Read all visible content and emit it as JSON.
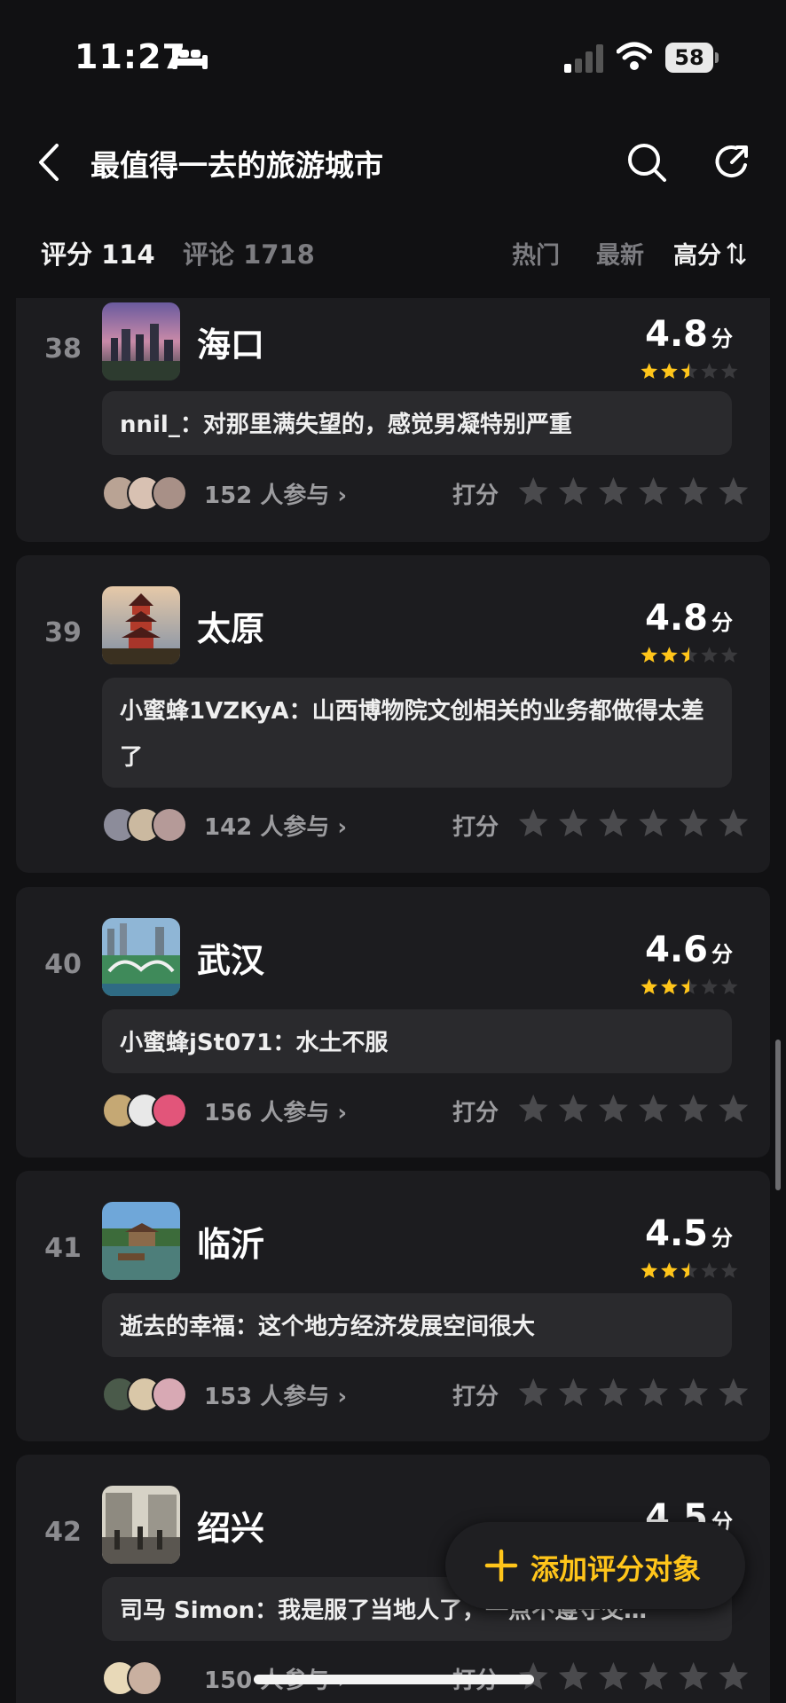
{
  "status_bar": {
    "time": "11:27",
    "battery": "58"
  },
  "nav": {
    "title": "最值得一去的旅游城市"
  },
  "tabs": {
    "ratings_label": "评分 114",
    "comments_label": "评论 1718",
    "sort_options": [
      "热门",
      "最新",
      "高分"
    ]
  },
  "score_unit": "分",
  "rate_label": "打分",
  "items": [
    {
      "rank": "38",
      "city": "海口",
      "score": "4.8",
      "comment": "nnil_：对那里满失望的，感觉男凝特别严重",
      "participants": "152 人参与",
      "stars_filled": 2.5,
      "thumb": "city-skyline-image"
    },
    {
      "rank": "39",
      "city": "太原",
      "score": "4.8",
      "comment": "小蜜蜂1VZKyA：山西博物院文创相关的业务都做得太差了",
      "participants": "142 人参与",
      "stars_filled": 2.5,
      "thumb": "pagoda-image"
    },
    {
      "rank": "40",
      "city": "武汉",
      "score": "4.6",
      "comment": "小蜜蜂jSt071：水土不服",
      "participants": "156 人参与",
      "stars_filled": 2.5,
      "thumb": "city-bridge-image"
    },
    {
      "rank": "41",
      "city": "临沂",
      "score": "4.5",
      "comment": "逝去的幸福：这个地方经济发展空间很大",
      "participants": "153 人参与",
      "stars_filled": 2.5,
      "thumb": "river-town-image"
    },
    {
      "rank": "42",
      "city": "绍兴",
      "score": "4.5",
      "comment": "司马 Simon：我是服了当地人了，一点不遵守交…",
      "participants": "150 人参与",
      "stars_filled": 2.5,
      "thumb": "old-street-photo"
    }
  ],
  "fab": {
    "label": "添加评分对象"
  },
  "colors": {
    "accent": "#ffc51a",
    "background": "#111113",
    "card": "#1c1c1f",
    "comment_bg": "#2a2a2d"
  }
}
